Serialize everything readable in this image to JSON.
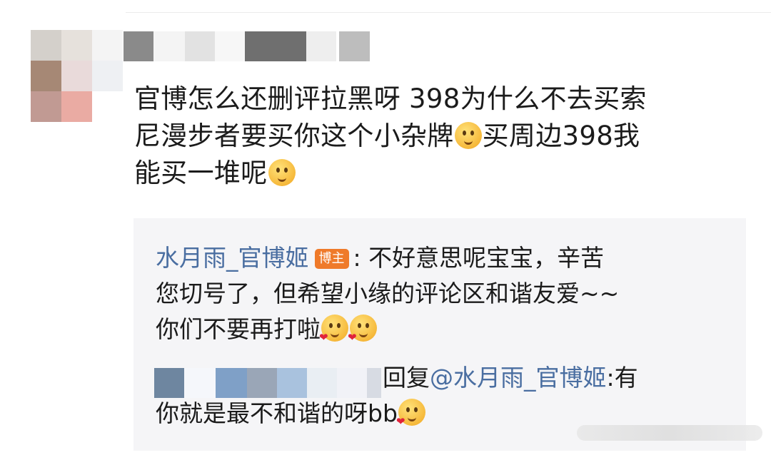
{
  "comment": {
    "line1": "官博怎么还删评拉黑呀 398为什么不去买索",
    "line2_a": "尼漫步者要买你这个小杂牌",
    "line2_b": "买周边398我",
    "line3_a": "能买一堆呢"
  },
  "reply1": {
    "author": "水月雨_官博姬",
    "badge": "博主",
    "text_a": ": 不好意思呢宝宝，辛苦",
    "text_b": "您切号了，但希望小缘的评论区和谐友爱~~",
    "text_c": "你们不要再打啦"
  },
  "reply2": {
    "prefix": "回复",
    "mention": "@水月雨_官博姬",
    "text_a": ":有",
    "text_b": "你就是最不和谐的呀bb"
  },
  "colors": {
    "link": "#4a6ea1",
    "badge_bg": "#ef7a2a",
    "reply_bg": "#f5f5f7"
  },
  "icons": {
    "emoji_thinking": "thinking-emoji",
    "emoji_hug": "hug-emoji",
    "emoji_kiss": "kiss-emoji"
  }
}
